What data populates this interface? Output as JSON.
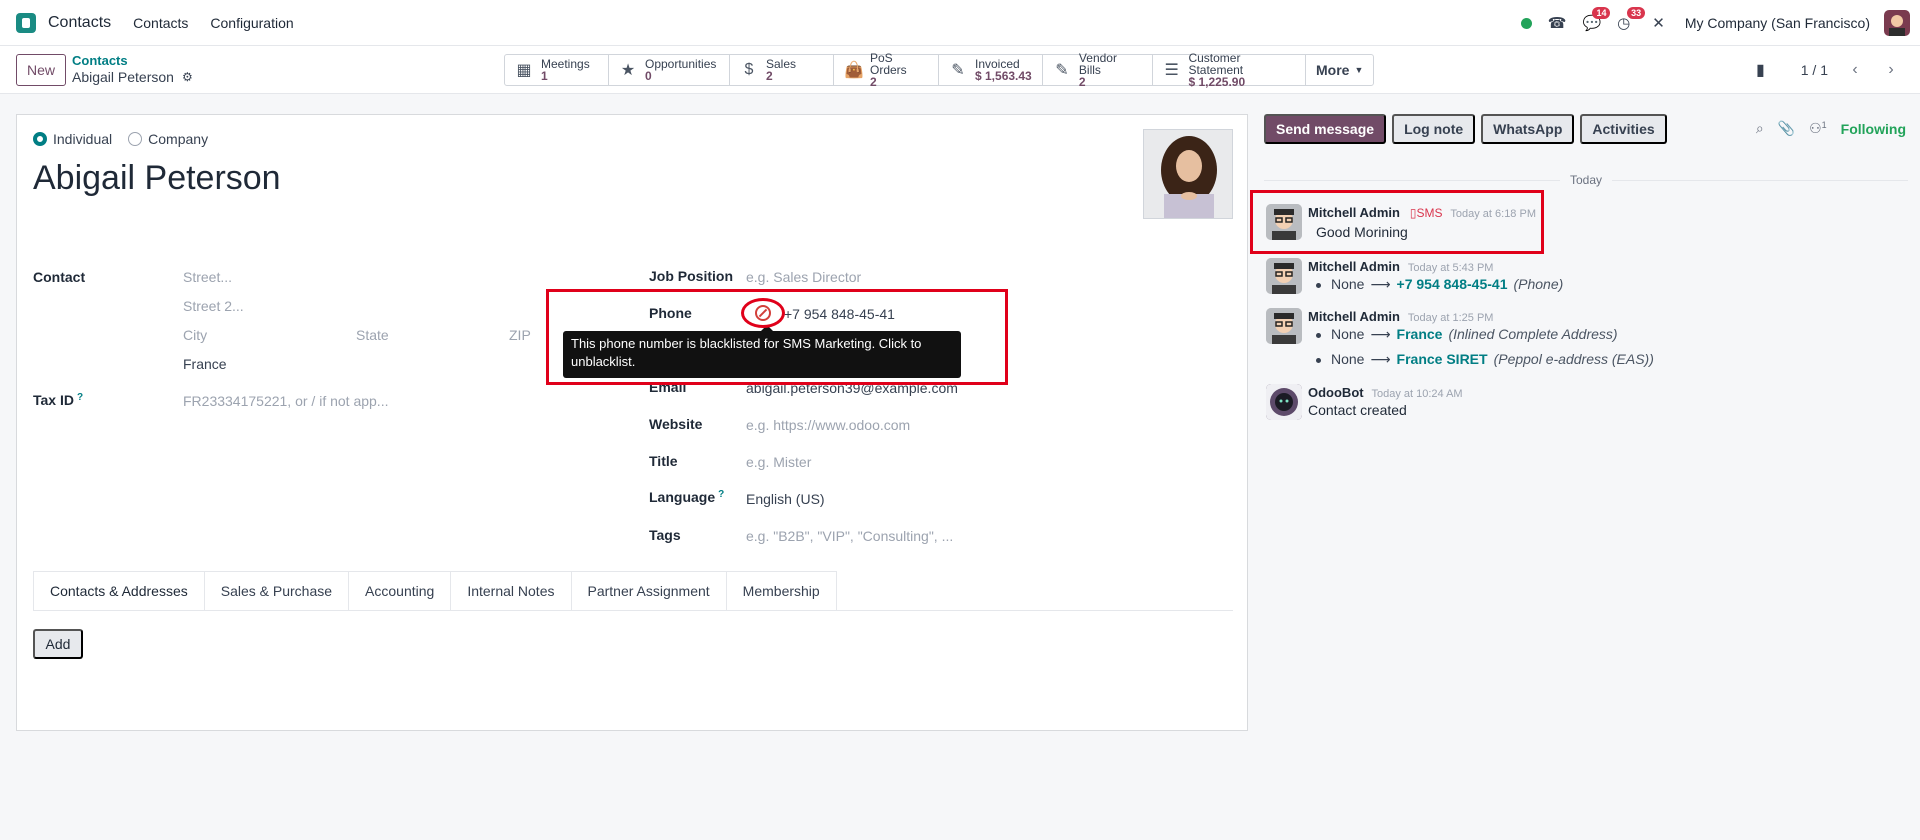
{
  "topnav": {
    "app_name": "Contacts",
    "menus": [
      "Contacts",
      "Configuration"
    ],
    "chat_badge": "14",
    "activity_badge": "33",
    "company": "My Company (San Francisco)"
  },
  "control": {
    "new_label": "New",
    "breadcrumb_parent": "Contacts",
    "breadcrumb_current": "Abigail Peterson",
    "stats": [
      {
        "label": "Meetings",
        "value": "1",
        "icon": "calendar-icon"
      },
      {
        "label": "Opportunities",
        "value": "0",
        "icon": "star-icon"
      },
      {
        "label": "Sales",
        "value": "2",
        "icon": "dollar-icon"
      },
      {
        "label": "PoS Orders",
        "value": "2",
        "icon": "shopping-bag-icon"
      },
      {
        "label": "Invoiced",
        "value": "$ 1,563.43",
        "icon": "pencil-square-icon"
      },
      {
        "label": "Vendor Bills",
        "value": "2",
        "icon": "pencil-square-icon"
      },
      {
        "label": "Customer Statement",
        "value": "$ 1,225.90",
        "icon": "list-icon"
      }
    ],
    "more_label": "More",
    "pager": "1 / 1"
  },
  "form": {
    "type_individual": "Individual",
    "type_company": "Company",
    "name": "Abigail Peterson",
    "contact_label": "Contact",
    "street_ph": "Street...",
    "street2_ph": "Street 2...",
    "city_ph": "City",
    "state_ph": "State",
    "zip_ph": "ZIP",
    "country": "France",
    "taxid_label": "Tax ID",
    "taxid_ph": "FR23334175221, or / if not app...",
    "job_label": "Job Position",
    "job_ph": "e.g. Sales Director",
    "phone_label": "Phone",
    "phone_value": "+7 954 848-45-41",
    "tooltip": "This phone number is blacklisted for SMS Marketing. Click to unblacklist.",
    "email_label": "Email",
    "email_value": "abigail.peterson39@example.com",
    "website_label": "Website",
    "website_ph": "e.g. https://www.odoo.com",
    "title_label": "Title",
    "title_ph": "e.g. Mister",
    "language_label": "Language",
    "language_value": "English (US)",
    "tags_label": "Tags",
    "tags_ph": "e.g. \"B2B\", \"VIP\", \"Consulting\", ...",
    "help_mark": "?",
    "tabs": [
      "Contacts & Addresses",
      "Sales & Purchase",
      "Accounting",
      "Internal Notes",
      "Partner Assignment",
      "Membership"
    ],
    "add_label": "Add"
  },
  "chatter": {
    "send_message": "Send message",
    "log_note": "Log note",
    "whatsapp": "WhatsApp",
    "activities": "Activities",
    "followers_count": "1",
    "following": "Following",
    "today": "Today",
    "messages": [
      {
        "author": "Mitchell Admin",
        "tag": "SMS",
        "time": "Today at 6:18 PM",
        "body": "Good Morining"
      },
      {
        "author": "Mitchell Admin",
        "time": "Today at 5:43 PM",
        "old": "None",
        "new": "+7 954 848-45-41",
        "field": "(Phone)"
      },
      {
        "author": "Mitchell Admin",
        "time": "Today at 1:25 PM",
        "changes": [
          {
            "old": "None",
            "new": "France",
            "field": "(Inlined Complete Address)"
          },
          {
            "old": "None",
            "new": "France SIRET",
            "field": "(Peppol e-address (EAS))"
          }
        ]
      },
      {
        "author": "OdooBot",
        "time": "Today at 10:24 AM",
        "body": "Contact created"
      }
    ]
  },
  "colors": {
    "brand": "#714b67",
    "link": "#017e84",
    "highlight": "#e0001a",
    "online": "#22a35a"
  }
}
